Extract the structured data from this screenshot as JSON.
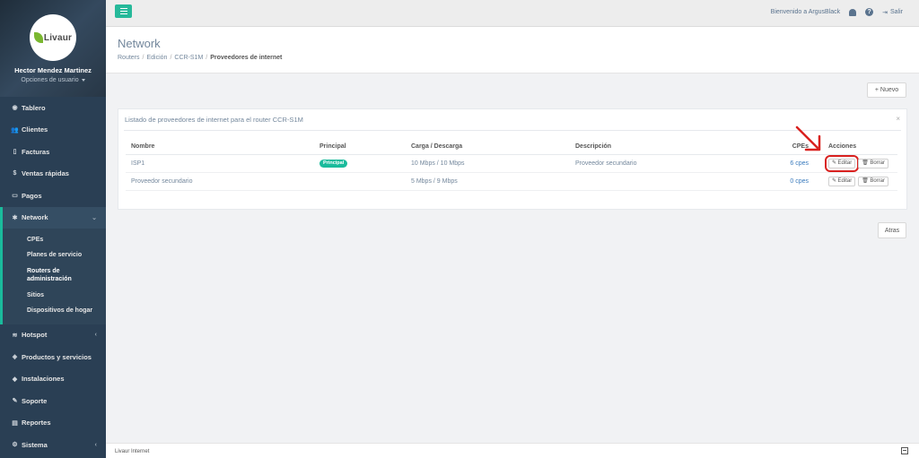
{
  "sidebar": {
    "logo_text": "Livaur",
    "user_name": "Hector Mendez Martinez",
    "user_options": "Opciones de usuario",
    "items": [
      {
        "label": "Tablero",
        "icon": "dashboard-icon",
        "glyph": "◉"
      },
      {
        "label": "Clientes",
        "icon": "users-icon",
        "glyph": "👥"
      },
      {
        "label": "Facturas",
        "icon": "file-icon",
        "glyph": "▯"
      },
      {
        "label": "Ventas rápidas",
        "icon": "dollar-icon",
        "glyph": "$"
      },
      {
        "label": "Pagos",
        "icon": "money-icon",
        "glyph": "▭"
      },
      {
        "label": "Network",
        "icon": "sitemap-icon",
        "glyph": "✱"
      },
      {
        "label": "Hotspot",
        "icon": "wifi-icon",
        "glyph": "≋"
      },
      {
        "label": "Productos y servicios",
        "icon": "tag-icon",
        "glyph": "◈"
      },
      {
        "label": "Instalaciones",
        "icon": "tag2-icon",
        "glyph": "◆"
      },
      {
        "label": "Soporte",
        "icon": "wrench-icon",
        "glyph": "✎"
      },
      {
        "label": "Reportes",
        "icon": "book-icon",
        "glyph": "▤"
      },
      {
        "label": "Sistema",
        "icon": "cogs-icon",
        "glyph": "⚙"
      }
    ],
    "network_sub": [
      {
        "label": "CPEs"
      },
      {
        "label": "Planes de servicio"
      },
      {
        "label": "Routers de administración"
      },
      {
        "label": "Sitios"
      },
      {
        "label": "Dispositivos de hogar"
      }
    ]
  },
  "topbar": {
    "welcome": "Bienvenido a ArgusBlack",
    "logout": "Salir"
  },
  "page": {
    "title": "Network",
    "breadcrumb": [
      "Routers",
      "Edición",
      "CCR-S1M",
      "Proveedores de internet"
    ]
  },
  "toolbar": {
    "new_label": "Nuevo",
    "back_label": "Atras"
  },
  "panel": {
    "title": "Listado de proveedores de internet para el router CCR-S1M",
    "close": "×"
  },
  "table": {
    "headers": [
      "Nombre",
      "Principal",
      "Carga / Descarga",
      "Descripción",
      "CPEs",
      "Acciones"
    ],
    "rows": [
      {
        "name": "ISP1",
        "principal": "Principal",
        "speed": "10 Mbps / 10 Mbps",
        "description": "Proveedor secundario",
        "cpes": "6 cpes"
      },
      {
        "name": "Proveedor secundario",
        "principal": "",
        "speed": "5 Mbps / 9 Mbps",
        "description": "",
        "cpes": "0 cpes"
      }
    ],
    "edit_label": "Editar",
    "delete_label": "Borrar"
  },
  "footer": {
    "text": "Livaur Internet"
  },
  "colors": {
    "accent": "#1abb9c",
    "sidebar": "#2a3f54",
    "highlight": "#d9211f"
  }
}
